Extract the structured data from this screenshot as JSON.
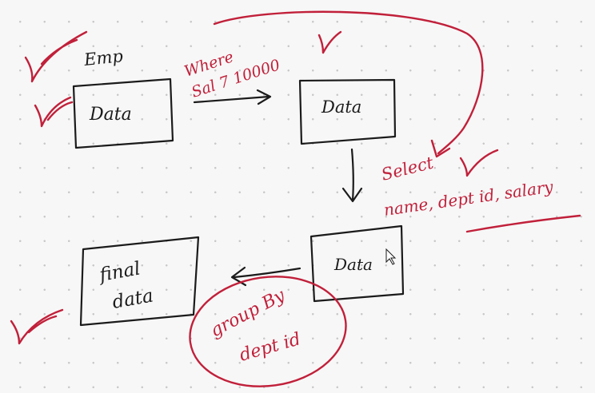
{
  "board": {
    "background": "#f7f7f7",
    "ink_color": "#1b1b1b",
    "annotation_color": "#c1203a"
  },
  "labels": {
    "emp": "Emp",
    "box1": "Data",
    "box2": "Data",
    "box3": "Data",
    "final_line1": "final",
    "final_line2": "data",
    "where": "Where",
    "condition": "Sal 7 10000",
    "select": "Select",
    "columns": "name, dept id, salary",
    "group_by_line1": "group By",
    "group_by_line2": "dept id"
  },
  "icons": {
    "check": "check-mark-icon",
    "arrow": "arrow-icon"
  }
}
